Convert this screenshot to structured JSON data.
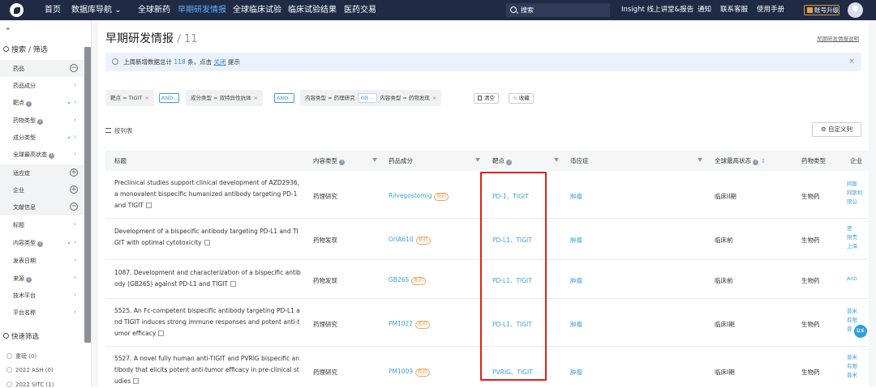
{
  "topnav": {
    "items": [
      "首页",
      "数据库导航",
      "全球新药",
      "早期研发情报",
      "全球临床试验",
      "临床试验结果",
      "医药交易"
    ],
    "database_nav_chevron": "⌄",
    "search_placeholder": "搜索",
    "right_items": [
      "Insight 线上讲堂&报告",
      "通知",
      "联系客服",
      "使用手册"
    ],
    "upgrade_label": "账号升级"
  },
  "sidebar": {
    "collapse": "«",
    "search_filter_title": "搜索 / 筛选",
    "groups": [
      {
        "label": "药品",
        "control": "−"
      },
      {
        "label": "药品成分",
        "control": "›"
      },
      {
        "label": "靶点",
        "control": "›"
      },
      {
        "label": "药物类型",
        "control": "›"
      },
      {
        "label": "成分类型",
        "control": "›"
      },
      {
        "label": "全球最高状态",
        "control": "›"
      },
      {
        "label": "适应症",
        "control": "+"
      },
      {
        "label": "企业",
        "control": "+"
      },
      {
        "label": "文献信息",
        "control": "−"
      },
      {
        "label": "标题",
        "control": "›"
      },
      {
        "label": "内容类型",
        "control": "›"
      },
      {
        "label": "发表日期",
        "control": "›"
      },
      {
        "label": "来源",
        "control": "›"
      },
      {
        "label": "技术平台",
        "control": "›"
      },
      {
        "label": "平台名称",
        "control": "›"
      }
    ],
    "quick_filter_title": "快速筛选",
    "quick_items": [
      "重磅 (0)",
      "2022 ASH (0)",
      "2022 SITC (1)"
    ]
  },
  "page": {
    "title": "早期研发情报",
    "count": "/ 11",
    "help_link": "早期研发情报说明"
  },
  "notice": {
    "text_before": "上周新增数据总计",
    "count": "118",
    "text_mid": "条，点击",
    "close_link": "关闭",
    "text_after": "提示",
    "close_icon": "×"
  },
  "filters": {
    "tag1": "靶点 = TIGIT",
    "and1": "AND⌵",
    "tag2": "成分类型 = 双特异性抗体",
    "and2": "AND⌵",
    "tag3_a": "内容类型 = 药理研究",
    "or_label": "OR ⌵",
    "tag3_b": "内容类型 = 药物发现",
    "clear_button": "清空",
    "save_button": "收藏",
    "remove_icon": "×"
  },
  "toolbar": {
    "list_mode": "按列表",
    "custom_columns": "自定义列"
  },
  "table": {
    "headers": [
      "标题",
      "内容类型",
      "药品成分",
      "靶点",
      "适应症",
      "全球最高状态",
      "药物类型",
      "企业"
    ],
    "rows": [
      {
        "title": "Preclinical studies support clinical development of AZD2936, a monovalent bispecific humanized antibody targeting PD-1 and TIGIT",
        "content_type": "药理研究",
        "drug": "Rilvegostomig",
        "new_tag": "新药",
        "targets": "PD-1、TIGIT",
        "indication": "肿瘤",
        "status": "临床II期",
        "drug_type": "生物药",
        "companies": [
          "阿斯",
          "阿斯利",
          "限公"
        ]
      },
      {
        "title": "Development of a bispecific antibody targeting PD-L1 and TIGIT with optimal cytotoxicity",
        "content_type": "药物发现",
        "drug": "OrIA610",
        "new_tag": "新药",
        "targets": "PD-L1、TIGIT",
        "indication": "肿瘤",
        "status": "临床前",
        "drug_type": "生物药",
        "companies": [
          "思",
          "限责",
          "上海"
        ]
      },
      {
        "title": "1087. Development and characterization of a bispecific antibody (GB265) against PD-L1 and TIGIT",
        "content_type": "药物发现",
        "drug": "GB265",
        "new_tag": "新药",
        "targets": "PD-L1、TIGIT",
        "indication": "肿瘤",
        "status": "临床前",
        "drug_type": "生物药",
        "companies": [
          "Anti"
        ]
      },
      {
        "title": "5525. An Fc-competent bispecific antibody targeting PD-L1 and TIGIT induces strong immune responses and potent anti-tumor efficacy",
        "content_type": "药理研究",
        "drug": "PM1022",
        "new_tag": "新药",
        "targets": "PD-L1、TIGIT",
        "indication": "肿瘤",
        "status": "临床I期",
        "drug_type": "生物药",
        "companies": [
          "普米",
          "有限",
          "普"
        ]
      },
      {
        "title": "5527. A novel fully human anti-TIGIT and PVRIG bispecific antibody that elicits potent anti-tumor efficacy in pre-clinical studies",
        "content_type": "药理研究",
        "drug": "PM1009",
        "new_tag": "新药",
        "targets": "PVRIG、TIGIT",
        "indication": "肿瘤",
        "status": "临床I期",
        "drug_type": "生物药",
        "companies": [
          "普米",
          "有限",
          "普米"
        ]
      }
    ]
  },
  "float_button": "联系"
}
